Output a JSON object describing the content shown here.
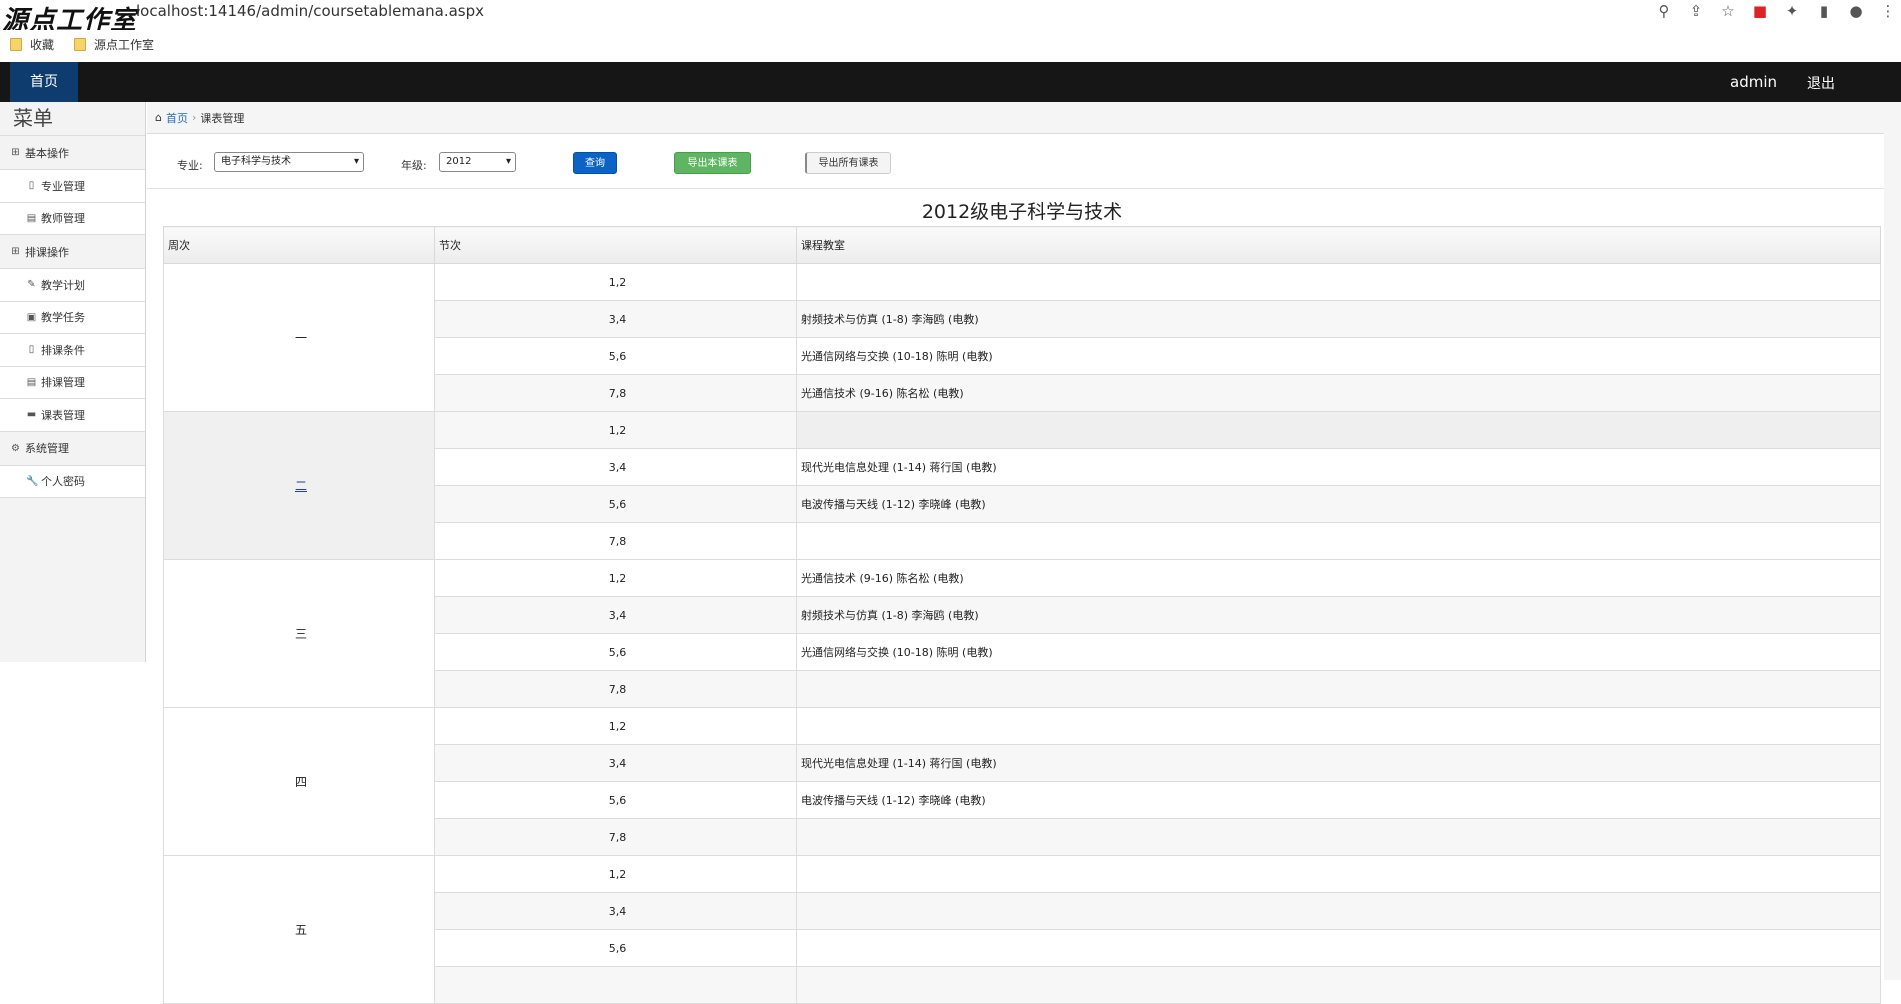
{
  "browser": {
    "watermark": "源点工作室",
    "url": "localhost:14146/admin/coursetablemana.aspx",
    "bookmarks": [
      "收藏",
      "源点工作室"
    ]
  },
  "navbar": {
    "home": "首页",
    "user": "admin",
    "logout": "退出"
  },
  "sidebar": {
    "title": "菜单",
    "groups": [
      {
        "label": "基本操作",
        "items": [
          "专业管理",
          "教师管理"
        ]
      },
      {
        "label": "排课操作",
        "items": [
          "教学计划",
          "教学任务",
          "排课条件",
          "排课管理",
          "课表管理"
        ]
      },
      {
        "label": "系统管理",
        "items": [
          "个人密码"
        ]
      }
    ]
  },
  "breadcrumb": {
    "home": "首页",
    "current": "课表管理"
  },
  "filters": {
    "major_label": "专业:",
    "major_value": "电子科学与技术",
    "grade_label": "年级:",
    "grade_value": "2012",
    "query_button": "查询",
    "export_this": "导出本课表",
    "export_all": "导出所有课表"
  },
  "table": {
    "title": "2012级电子科学与技术",
    "headers": [
      "周次",
      "节次",
      "课程教室"
    ],
    "weeks": [
      {
        "day": "一",
        "rows": [
          {
            "slot": "1,2",
            "course": ""
          },
          {
            "slot": "3,4",
            "course": "射频技术与仿真 (1-8) 李海鸥 (电教)"
          },
          {
            "slot": "5,6",
            "course": "光通信网络与交换 (10-18) 陈明 (电教)"
          },
          {
            "slot": "7,8",
            "course": "光通信技术 (9-16) 陈名松 (电教)"
          }
        ]
      },
      {
        "day": "二",
        "rows": [
          {
            "slot": "1,2",
            "course": ""
          },
          {
            "slot": "3,4",
            "course": "现代光电信息处理 (1-14) 蒋行国 (电教)"
          },
          {
            "slot": "5,6",
            "course": "电波传播与天线 (1-12) 李晓峰 (电教)"
          },
          {
            "slot": "7,8",
            "course": ""
          }
        ]
      },
      {
        "day": "三",
        "rows": [
          {
            "slot": "1,2",
            "course": "光通信技术 (9-16) 陈名松 (电教)"
          },
          {
            "slot": "3,4",
            "course": "射频技术与仿真 (1-8) 李海鸥 (电教)"
          },
          {
            "slot": "5,6",
            "course": "光通信网络与交换 (10-18) 陈明 (电教)"
          },
          {
            "slot": "7,8",
            "course": ""
          }
        ]
      },
      {
        "day": "四",
        "rows": [
          {
            "slot": "1,2",
            "course": ""
          },
          {
            "slot": "3,4",
            "course": "现代光电信息处理 (1-14) 蒋行国 (电教)"
          },
          {
            "slot": "5,6",
            "course": "电波传播与天线 (1-12) 李晓峰 (电教)"
          },
          {
            "slot": "7,8",
            "course": ""
          }
        ]
      },
      {
        "day": "五",
        "rows": [
          {
            "slot": "1,2",
            "course": ""
          },
          {
            "slot": "3,4",
            "course": ""
          },
          {
            "slot": "5,6",
            "course": ""
          }
        ]
      }
    ]
  }
}
